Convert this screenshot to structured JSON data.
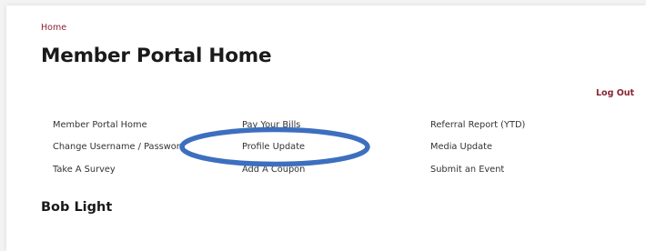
{
  "breadcrumb": {
    "home_label": "Home"
  },
  "page": {
    "title": "Member Portal Home"
  },
  "header": {
    "logout_label": "Log Out"
  },
  "nav": {
    "col1": [
      {
        "label": "Member Portal Home"
      },
      {
        "label": "Change Username / Password"
      },
      {
        "label": "Take A Survey"
      }
    ],
    "col2": [
      {
        "label": "Pay Your Bills"
      },
      {
        "label": "Profile Update"
      },
      {
        "label": "Add A Coupon"
      }
    ],
    "col3": [
      {
        "label": "Referral Report (YTD)"
      },
      {
        "label": "Media Update"
      },
      {
        "label": "Submit an Event"
      }
    ]
  },
  "member": {
    "name": "Bob Light"
  },
  "annotation": {
    "ellipse_color": "#3d6fbf",
    "highlighted_item": "Profile Update"
  },
  "colors": {
    "accent": "#8b2332",
    "text": "#333333",
    "heading": "#1a1a1a"
  }
}
